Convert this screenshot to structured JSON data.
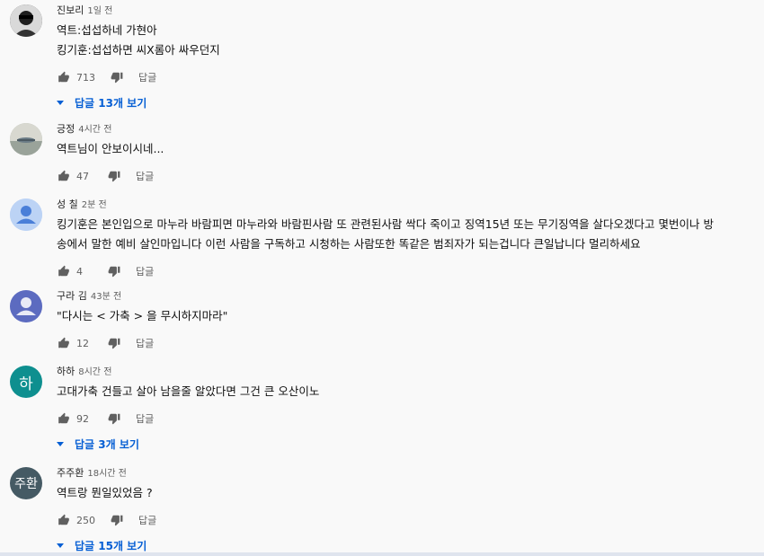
{
  "comments": [
    {
      "author": "진보리",
      "time": "1일 전",
      "lines": [
        "역트:섭섭하네 가현아",
        "킹기훈:섭섭하면 씨X롬아 싸우던지"
      ],
      "likes": "713",
      "reply_label": "답글",
      "replies_label": "답글 13개 보기",
      "avatar": {
        "kind": "photo",
        "color": "#2b2b2b"
      }
    },
    {
      "author": "긍정",
      "time": "4시간 전",
      "lines": [
        "역트님이 안보이시네..."
      ],
      "likes": "47",
      "reply_label": "답글",
      "avatar": {
        "kind": "photo",
        "color": "#a9b3a8"
      }
    },
    {
      "author": "성 칠",
      "time": "2분 전",
      "lines": [
        "킹기훈은 본인입으로 마누라 바람피면 마누라와 바람핀사람 또 관련된사람 싹다 죽이고 징역15년 또는 무기징역을 살다오겠다고 몇번이나 방",
        "송에서 말한 예비 살인마입니다 이런 사람을 구독하고 시청하는 사람또한 똑같은 범죄자가 되는겁니다 큰일납니다 멀리하세요"
      ],
      "likes": "4",
      "reply_label": "답글",
      "avatar": {
        "kind": "default",
        "color": "#bcd3f5"
      }
    },
    {
      "author": "구라 김",
      "time": "43분 전",
      "lines": [
        "\"다시는 < 가축 > 을 무시하지마라\""
      ],
      "likes": "12",
      "reply_label": "답글",
      "avatar": {
        "kind": "default",
        "color": "#c7c9f0"
      }
    },
    {
      "author": "하하",
      "time": "8시간 전",
      "lines": [
        "고대가축 건들고 살아 남을줄 알았다면 그건 큰 오산이노"
      ],
      "likes": "92",
      "reply_label": "답글",
      "replies_label": "답글 3개 보기",
      "avatar": {
        "kind": "letter",
        "letter": "하",
        "color": "#0e8f8f"
      }
    },
    {
      "author": "주주환",
      "time": "18시간 전",
      "lines": [
        "역트랑 뭔일있었음 ?"
      ],
      "likes": "250",
      "reply_label": "답글",
      "replies_label": "답글 15개 보기",
      "avatar": {
        "kind": "letter",
        "letter": "주환",
        "color": "#455a64"
      }
    }
  ]
}
